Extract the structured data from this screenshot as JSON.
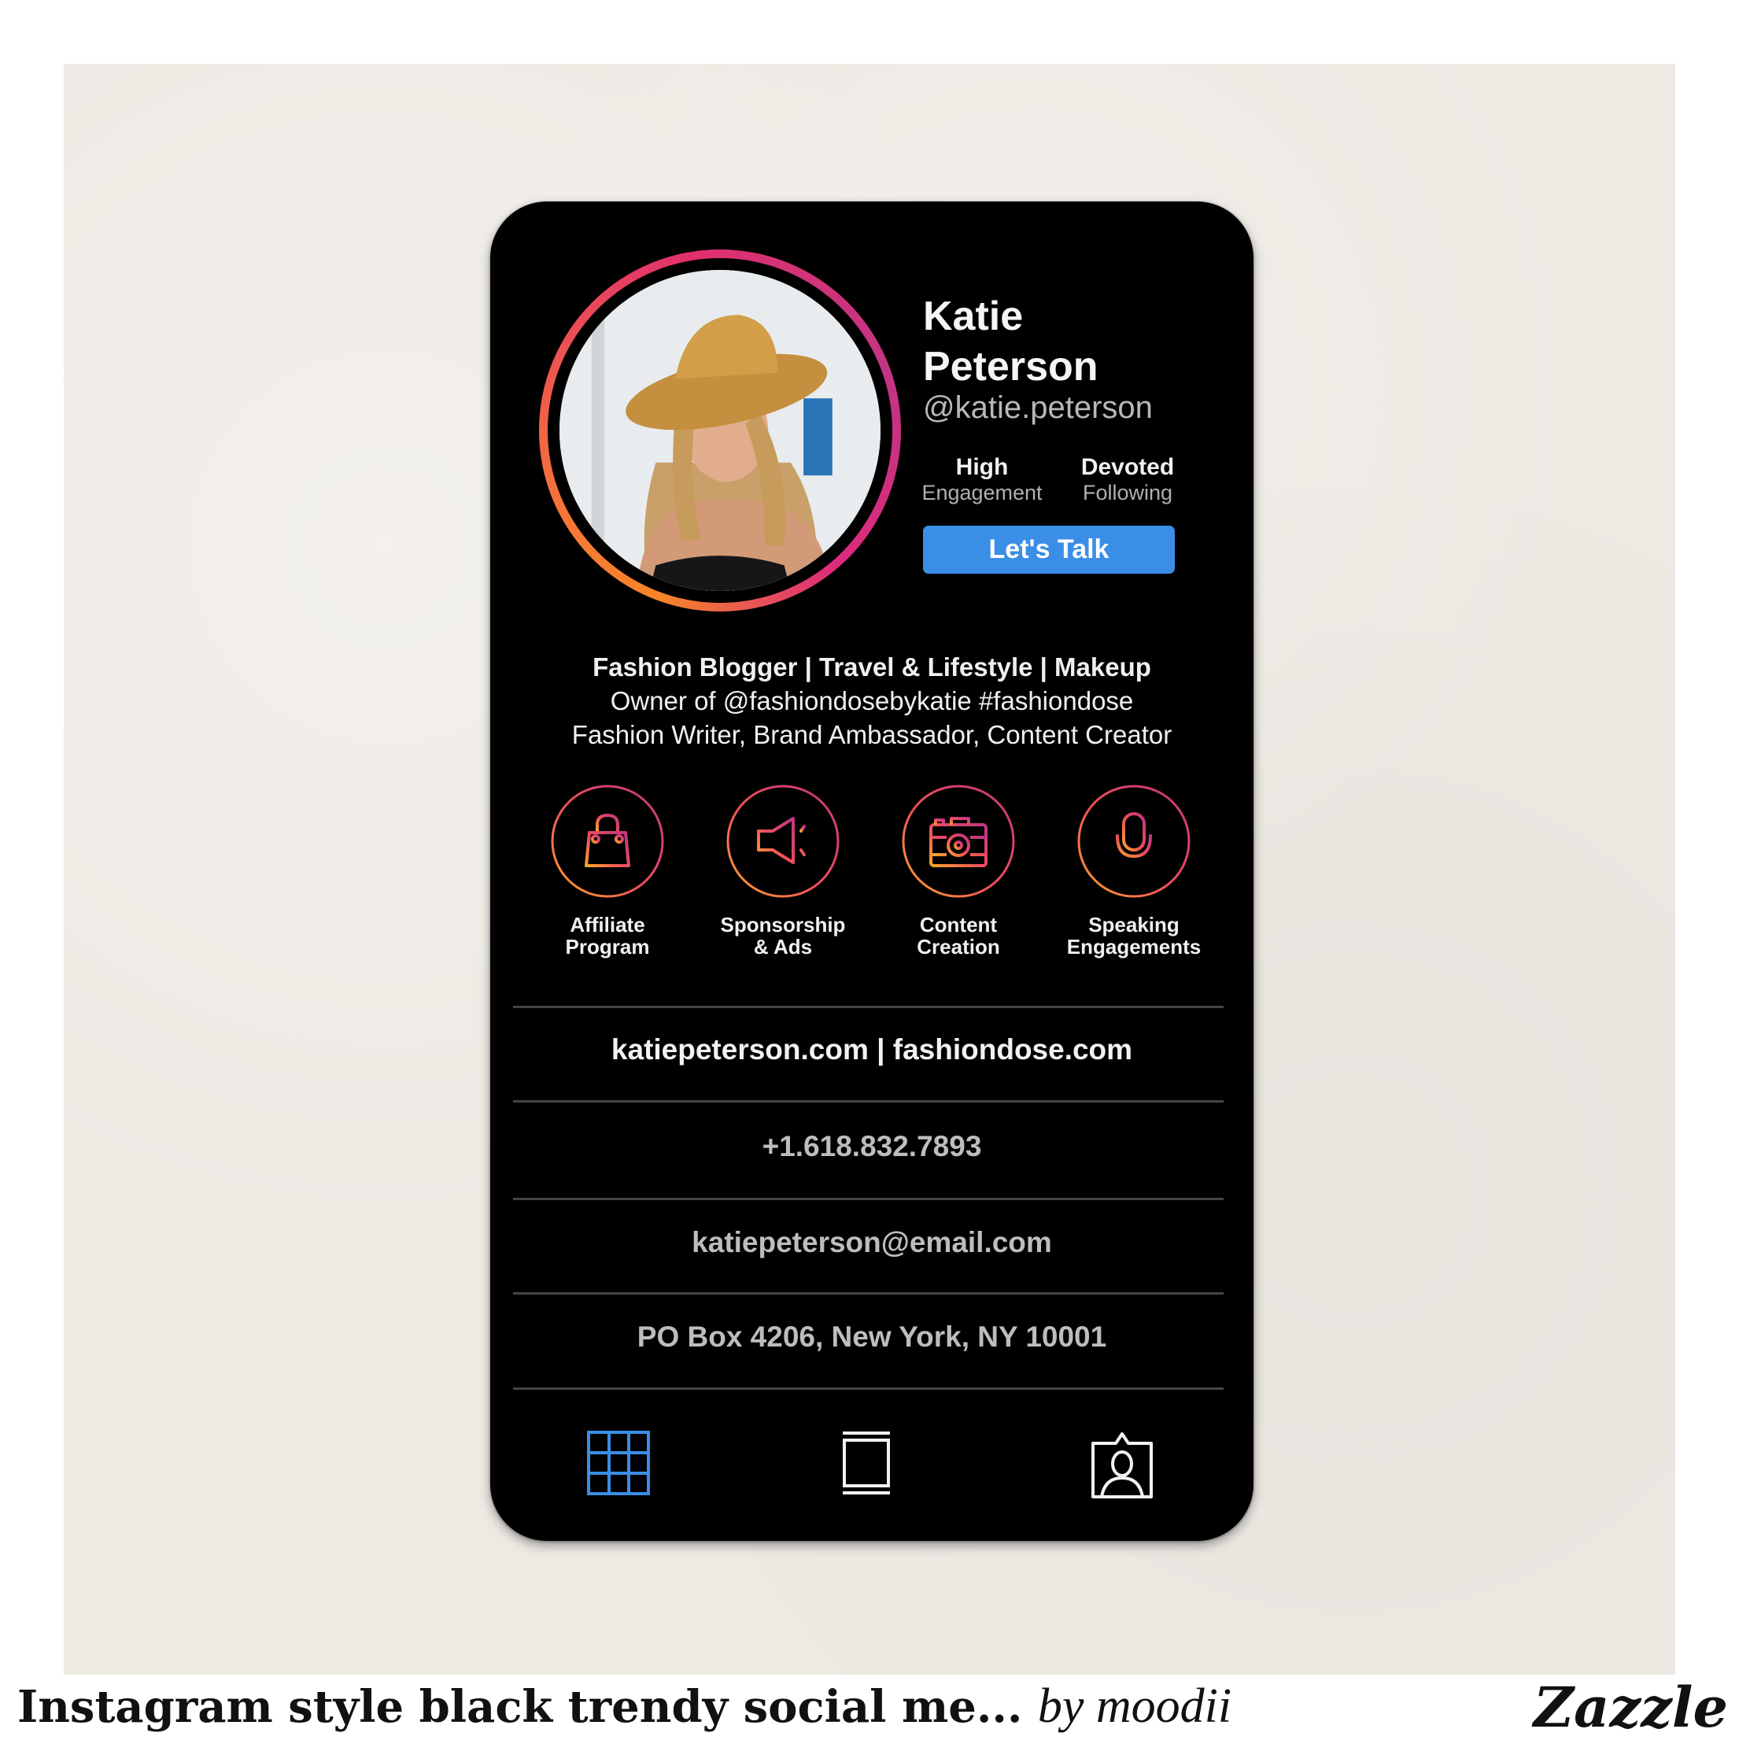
{
  "profile": {
    "first_name": "Katie",
    "last_name": "Peterson",
    "handle": "@katie.peterson",
    "stats": [
      {
        "value": "High",
        "label": "Engagement"
      },
      {
        "value": "Devoted",
        "label": "Following"
      }
    ],
    "cta_label": "Let's Talk",
    "photo_alt": "profile-photo"
  },
  "bio": {
    "line1": "Fashion Blogger | Travel & Lifestyle | Makeup",
    "line2": "Owner of @fashiondosebykatie #fashiondose",
    "line3": "Fashion Writer, Brand Ambassador, Content Creator"
  },
  "services": [
    {
      "icon": "shopping-bag-icon",
      "line1": "Affiliate",
      "line2": "Program"
    },
    {
      "icon": "megaphone-icon",
      "line1": "Sponsorship",
      "line2": "& Ads"
    },
    {
      "icon": "camera-icon",
      "line1": "Content",
      "line2": "Creation"
    },
    {
      "icon": "microphone-icon",
      "line1": "Speaking",
      "line2": "Engagements"
    }
  ],
  "contact": {
    "websites": "katiepeterson.com | fashiondose.com",
    "phone": "+1.618.832.7893",
    "email": "katiepeterson@email.com",
    "address": "PO Box 4206, New York, NY 10001"
  },
  "nav": [
    {
      "icon": "grid-icon",
      "active": true
    },
    {
      "icon": "feed-icon",
      "active": false
    },
    {
      "icon": "tagged-icon",
      "active": false
    }
  ],
  "colors": {
    "accent_blue": "#3a8ee6",
    "gradient_orange": "#f58529",
    "gradient_pink": "#dd2a7b",
    "gradient_purple": "#c13584",
    "card": "#000000",
    "paper": "#ede9e3"
  },
  "caption": {
    "title": "Instagram style black trendy social me...",
    "by": "by moodii",
    "brand": "Zazzle"
  }
}
